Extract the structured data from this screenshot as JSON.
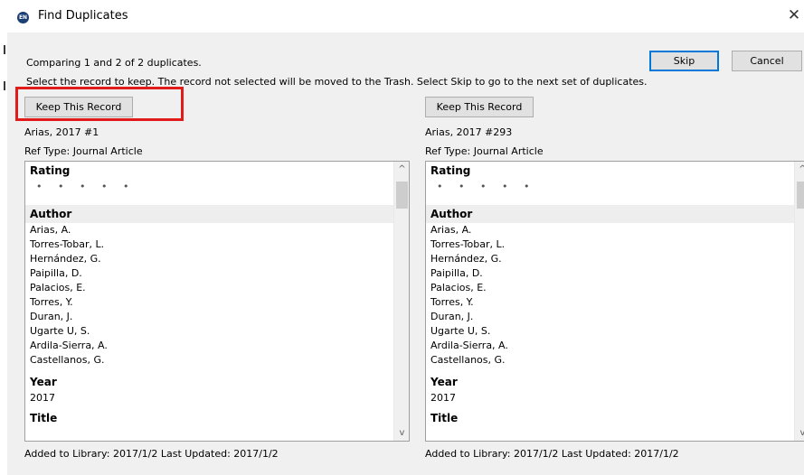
{
  "window": {
    "title": "Find Duplicates",
    "icon_label": "EN",
    "close_glyph": "✕"
  },
  "header": {
    "status": "Comparing 1 and 2 of 2 duplicates.",
    "instructions": "Select the record to keep. The record not selected will be moved to the Trash. Select Skip to go to the next set of duplicates.",
    "skip_label": "Skip",
    "cancel_label": "Cancel"
  },
  "left": {
    "keep_label": "Keep This Record",
    "record_id": "Arias, 2017 #1",
    "ref_type": "Ref Type: Journal Article",
    "rating_label": "Rating",
    "rating_dots": "• • • • •",
    "author_label": "Author",
    "authors": [
      "Arias, A.",
      "Torres-Tobar, L.",
      "Hernández, G.",
      "Paipilla, D.",
      "Palacios, E.",
      "Torres, Y.",
      "Duran, J.",
      "Ugarte U, S.",
      "Ardila-Sierra, A.",
      "Castellanos, G."
    ],
    "year_label": "Year",
    "year": "2017",
    "title_label": "Title",
    "footer": "Added to Library: 2017/1/2    Last Updated: 2017/1/2"
  },
  "right": {
    "keep_label": "Keep This Record",
    "record_id": "Arias, 2017 #293",
    "ref_type": "Ref Type: Journal Article",
    "rating_label": "Rating",
    "rating_dots": "• • • • •",
    "author_label": "Author",
    "authors": [
      "Arias, A.",
      "Torres-Tobar, L.",
      "Hernández, G.",
      "Paipilla, D.",
      "Palacios, E.",
      "Torres, Y.",
      "Duran, J.",
      "Ugarte U, S.",
      "Ardila-Sierra, A.",
      "Castellanos, G."
    ],
    "year_label": "Year",
    "year": "2017",
    "title_label": "Title",
    "footer": "Added to Library: 2017/1/2    Last Updated: 2017/1/2"
  },
  "scroll": {
    "up_glyph": "^",
    "down_glyph": "v"
  },
  "colors": {
    "highlight": "#e11a1a",
    "default_button_border": "#0078d7"
  }
}
